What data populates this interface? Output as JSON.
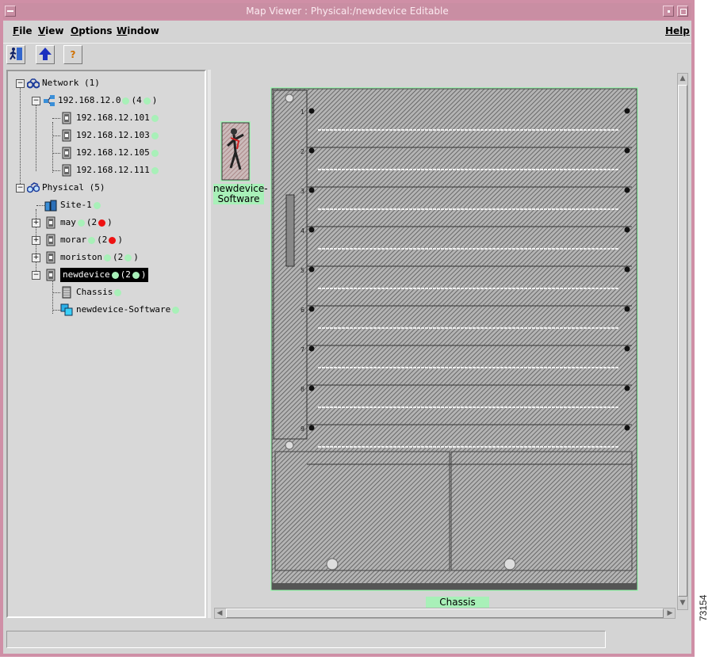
{
  "window": {
    "title": "Map Viewer : Physical:/newdevice     Editable"
  },
  "menubar": {
    "items": [
      {
        "label": "File",
        "underline": "F",
        "rest": "ile"
      },
      {
        "label": "View",
        "underline": "V",
        "rest": "iew"
      },
      {
        "label": "Options",
        "underline": "O",
        "rest": "ptions"
      },
      {
        "label": "Window",
        "underline": "W",
        "rest": "indow"
      }
    ],
    "help": "Help"
  },
  "toolbar": {
    "buttons": [
      {
        "icon": "exit-icon"
      },
      {
        "icon": "up-arrow-icon"
      },
      {
        "icon": "help-question-icon"
      }
    ],
    "help_glyph": "?"
  },
  "tree": {
    "network_label": "Network",
    "network_count": "(1)",
    "subnet_label": "192.168.12.0",
    "subnet_count_open": "(4",
    "subnet_count_close": ")",
    "hosts": [
      "192.168.12.101",
      "192.168.12.103",
      "192.168.12.105",
      "192.168.12.111"
    ],
    "physical_label": "Physical",
    "physical_count": "(5)",
    "site_label": "Site-1",
    "devices": [
      {
        "label": "may",
        "count_open": "(2",
        "status": "red",
        "count_close": ")"
      },
      {
        "label": "morar",
        "count_open": "(2",
        "status": "red",
        "count_close": ")"
      },
      {
        "label": "moriston",
        "count_open": "(2",
        "status": "green",
        "count_close": ")"
      },
      {
        "label": "newdevice",
        "count_open": "(2",
        "status": "green",
        "count_close": ")"
      }
    ],
    "children": [
      "Chassis",
      "newdevice-Software"
    ],
    "expander_minus": "−",
    "expander_plus": "+"
  },
  "map": {
    "software_label_line1": "newdevice-",
    "software_label_line2": "Software",
    "chassis_label": "Chassis",
    "slot_numbers": [
      "1",
      "2",
      "3",
      "4",
      "5",
      "6",
      "7",
      "8",
      "9"
    ]
  },
  "side_figure_number": "73154",
  "colors": {
    "window_frame": "#cf8fa6",
    "client_bg": "#d4d4d4",
    "status_ok": "#a8f0b8",
    "status_alarm": "#ee1111",
    "chassis_hatch": "#555555",
    "label_bg": "#a8f0b8"
  }
}
